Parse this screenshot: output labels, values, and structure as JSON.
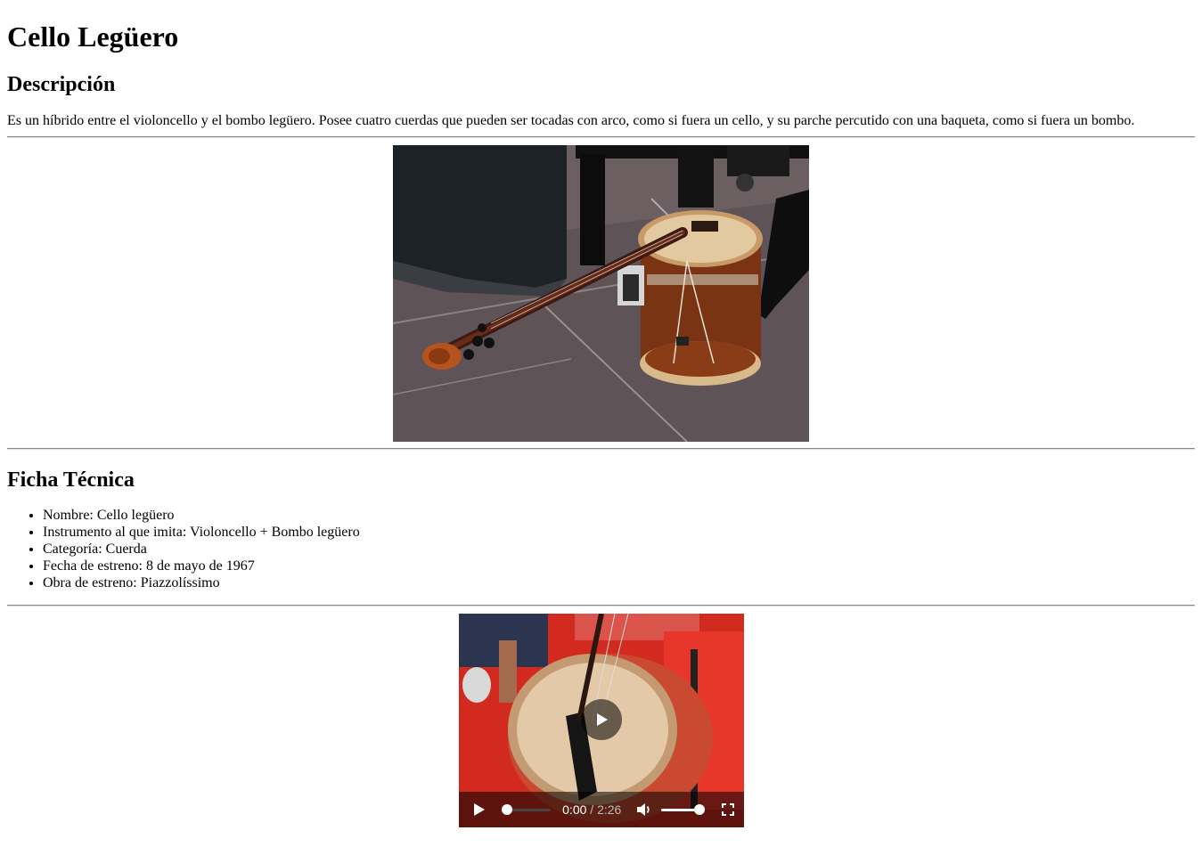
{
  "title": "Cello Legüero",
  "description": {
    "heading": "Descripción",
    "text": "Es un híbrido entre el violoncello y el bombo legüero. Posee cuatro cuerdas que pueden ser tocadas con arco, como si fuera un cello, y su parche percutido con una baqueta, como si fuera un bombo."
  },
  "ficha": {
    "heading": "Ficha Técnica",
    "items": [
      "Nombre: Cello legüero",
      "Instrumento al que imita: Violoncello + Bombo legüero",
      "Categoría: Cuerda",
      "Fecha de estreno: 8 de mayo de 1967",
      "Obra de estreno: Piazzolíssimo"
    ]
  },
  "video": {
    "current_time": "0:00",
    "separator": " / ",
    "duration": "2:26",
    "progress": 0.0,
    "volume": 1.0,
    "icons": [
      "play-icon",
      "volume-icon",
      "fullscreen-icon",
      "big-play-icon"
    ]
  }
}
